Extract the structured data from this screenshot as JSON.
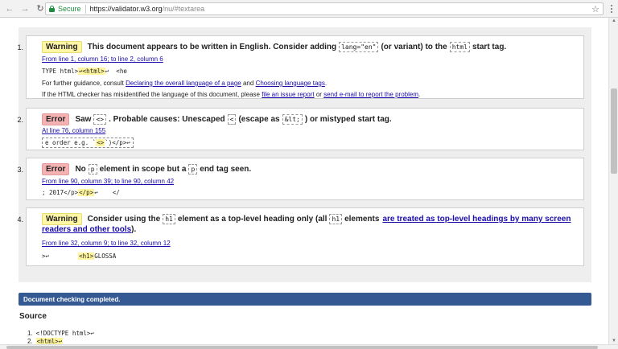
{
  "browser": {
    "back_icon": "arrow-left-icon",
    "forward_icon": "arrow-right-icon",
    "reload_icon": "reload-icon",
    "secure_label": "Secure",
    "url_host": "https://validator.w3.org",
    "url_rest": "/nu/#textarea"
  },
  "messages": [
    {
      "num": "1.",
      "type": "Warning",
      "parts": [
        "This document appears to be written in English. Consider adding",
        "lang=\"en\"",
        "(or variant) to the",
        "html",
        "start tag."
      ],
      "location": "From line 1, column 16; to line 2, column 6",
      "extract": [
        "TYPE html>",
        "↩<html>",
        "↩  <he"
      ],
      "guidance": {
        "prefix": "For further guidance, consult",
        "link1": "Declaring the overall language of a page",
        "and": "and",
        "link2": "Choosing language tags",
        "end": "."
      },
      "misidentified": {
        "prefix": "If the HTML checker has misidentified the language of this document, please",
        "link1": "file an issue report",
        "or": "or",
        "link2": "send e-mail to report the problem",
        "end": "."
      }
    },
    {
      "num": "2.",
      "type": "Error",
      "parts": [
        "Saw",
        "<>",
        ". Probable causes: Unescaped",
        "<",
        "(escape as",
        "&lt;",
        ") or mistyped start tag."
      ],
      "location": "At line 76, column 155",
      "extract": [
        "e order e.g. `",
        "<>",
        "`)</p>↩"
      ]
    },
    {
      "num": "3.",
      "type": "Error",
      "parts": [
        "No",
        "p",
        "element in scope but a",
        "p",
        "end tag seen."
      ],
      "location": "From line 90, column 39; to line 90, column 42",
      "extract": [
        "; 2017</p>",
        "</p>",
        "↩    </"
      ]
    },
    {
      "num": "4.",
      "type": "Warning",
      "parts": [
        "Consider using the",
        "h1",
        "element as a top-level heading only (all",
        "h1",
        "elements",
        "are treated as top-level headings by many screen",
        "readers and other tools",
        ")."
      ],
      "location": "From line 32, column 9; to line 32, column 12",
      "extract": [
        ">↩        ",
        "<h1>",
        "GLOSSA"
      ]
    }
  ],
  "status": "Document checking completed.",
  "source": {
    "heading": "Source",
    "lines": [
      {
        "n": "1.",
        "text": "<!DOCTYPE html>↩"
      },
      {
        "n": "2.",
        "text": "<html>↩"
      }
    ]
  },
  "colors": {
    "warning_badge": "#fff6a6",
    "error_badge": "#f5b2b2",
    "status_bar": "#355a93",
    "link": "#1a0dab",
    "secure": "#1e8e3e"
  }
}
